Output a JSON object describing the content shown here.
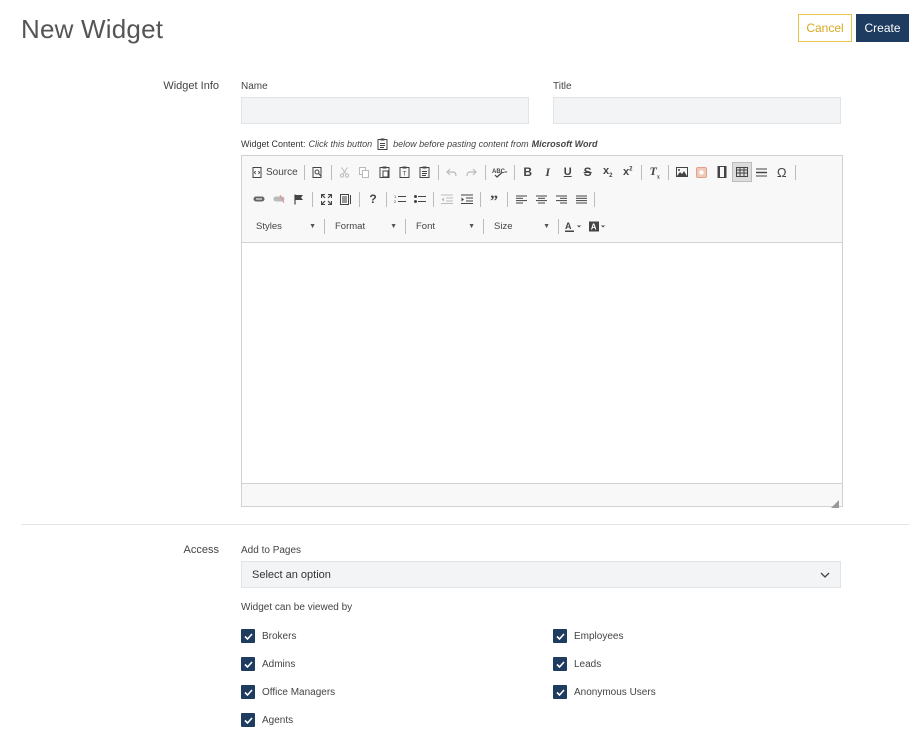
{
  "page": {
    "title": "New Widget"
  },
  "actions": {
    "cancel": "Cancel",
    "create": "Create"
  },
  "widget_info": {
    "section": "Widget Info",
    "name_label": "Name",
    "name_value": "",
    "title_label": "Title",
    "title_value": "",
    "content_label": "Widget Content:",
    "hint_before": "Click this button",
    "hint_after": "below before pasting content from",
    "hint_app": "Microsoft Word"
  },
  "editor": {
    "source_label": "Source",
    "combos": {
      "styles": "Styles",
      "format": "Format",
      "font": "Font",
      "size": "Size"
    },
    "icons": [
      "source-icon",
      "preview-icon",
      "cut-icon",
      "copy-icon",
      "paste-icon",
      "paste-text-icon",
      "paste-word-icon",
      "undo-icon",
      "redo-icon",
      "spellcheck-icon",
      "bold-icon",
      "italic-icon",
      "underline-icon",
      "strike-icon",
      "subscript-icon",
      "superscript-icon",
      "remove-format-icon",
      "image-icon",
      "flash-icon",
      "iframe-icon",
      "table-icon",
      "hr-icon",
      "special-char-icon",
      "link-icon",
      "unlink-icon",
      "anchor-icon",
      "maximize-icon",
      "show-blocks-icon",
      "about-icon",
      "numbered-list-icon",
      "bulleted-list-icon",
      "outdent-icon",
      "indent-icon",
      "blockquote-icon",
      "align-left-icon",
      "align-center-icon",
      "align-right-icon",
      "justify-icon",
      "text-color-icon",
      "bg-color-icon"
    ]
  },
  "access": {
    "section": "Access",
    "pages_label": "Add to Pages",
    "pages_value": "Select an option",
    "viewers_label": "Widget can be viewed by",
    "viewers": [
      {
        "label": "Brokers",
        "checked": true
      },
      {
        "label": "Admins",
        "checked": true
      },
      {
        "label": "Office Managers",
        "checked": true
      },
      {
        "label": "Agents",
        "checked": true
      },
      {
        "label": "Employees",
        "checked": true
      },
      {
        "label": "Leads",
        "checked": true
      },
      {
        "label": "Anonymous Users",
        "checked": true
      }
    ]
  },
  "colors": {
    "primary": "#1e3b60",
    "cancel": "#d9a922",
    "input_bg": "#f3f4f6"
  }
}
